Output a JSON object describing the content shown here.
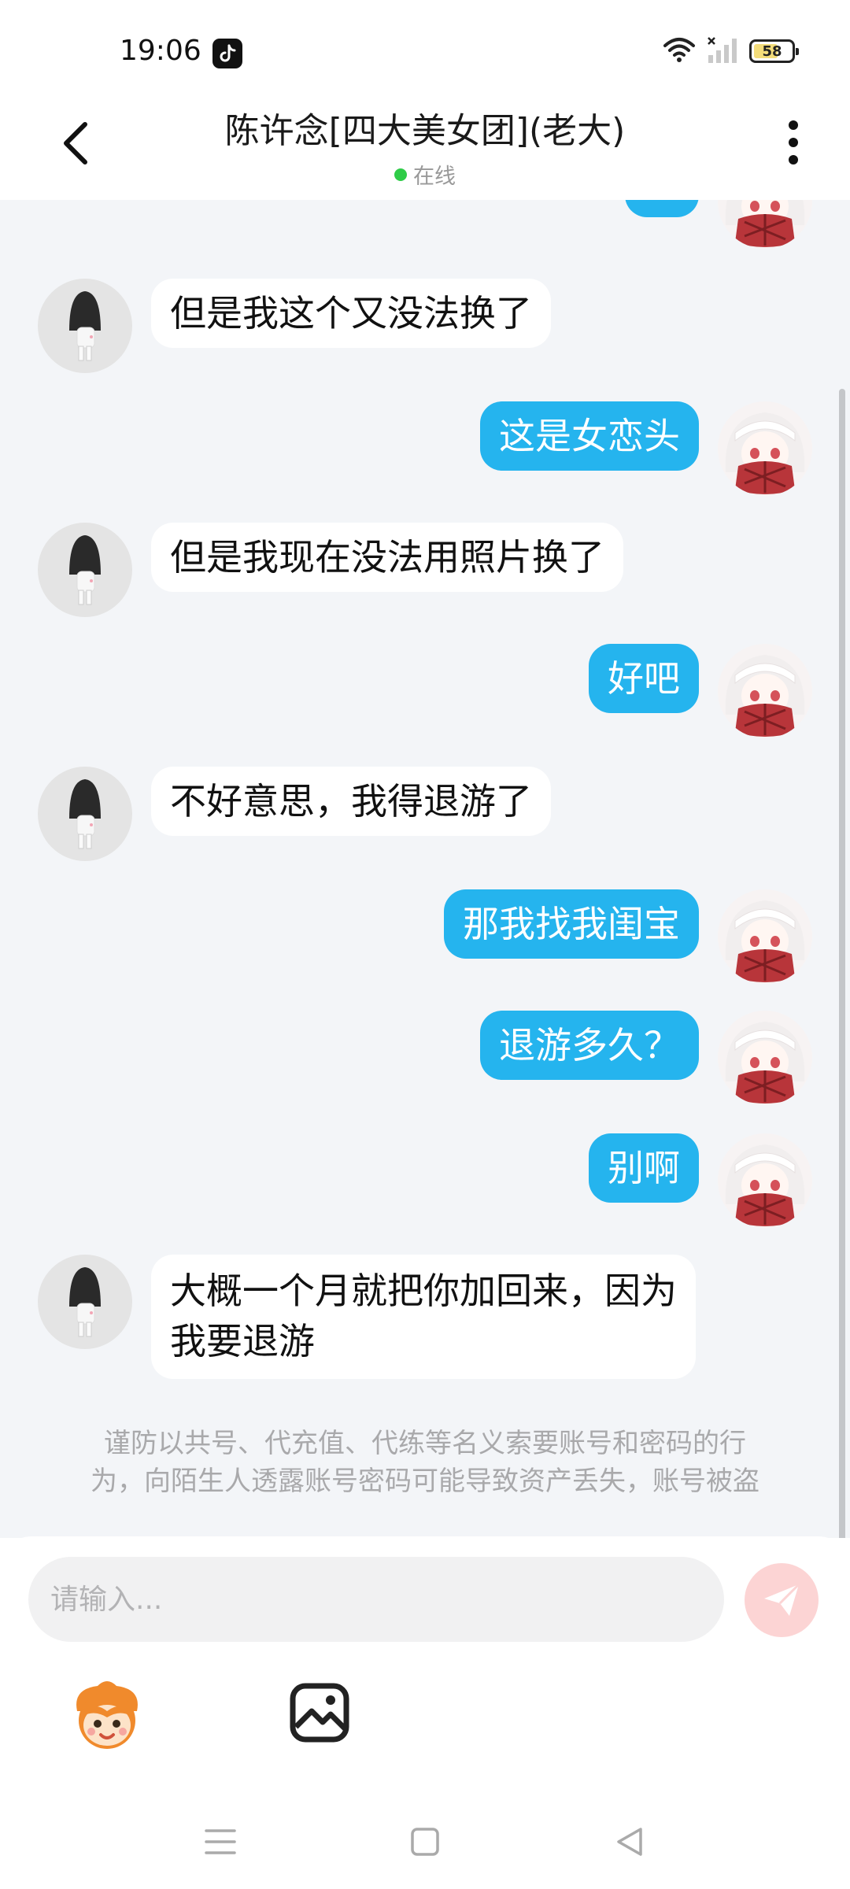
{
  "status_bar": {
    "time": "19:06",
    "battery_level": "58",
    "icons": [
      "tiktok-icon",
      "wifi-icon",
      "signal-icon",
      "battery-icon"
    ]
  },
  "header": {
    "title": "陈许念[四大美女团](老大)",
    "online_status": "在线",
    "online_color": "#2fcc48"
  },
  "messages": [
    {
      "side": "left",
      "text": "但是我这个又没法换了"
    },
    {
      "side": "right",
      "text": "这是女恋头"
    },
    {
      "side": "left",
      "text": "但是我现在没法用照片换了"
    },
    {
      "side": "right",
      "text": "好吧"
    },
    {
      "side": "left",
      "text": "不好意思，我得退游了"
    },
    {
      "side": "right",
      "text": "那我找我闺宝"
    },
    {
      "side": "right",
      "text": "退游多久？"
    },
    {
      "side": "right",
      "text": "别啊"
    },
    {
      "side": "left",
      "text_line1": "大概一个月就把你加回来，因为",
      "text_line2": "我要退游"
    }
  ],
  "notice": {
    "line1": "谨防以共号、代充值、代练等名义索要账号和密码的行",
    "line2": "为，向陌生人透露账号密码可能导致资产丢失，账号被盗"
  },
  "input": {
    "placeholder": "请输入..."
  },
  "colors": {
    "sent_bubble": "#25b4ee",
    "received_bubble": "#ffffff",
    "chat_background": "#f3f5f8",
    "send_button": "#fcd4d4"
  }
}
